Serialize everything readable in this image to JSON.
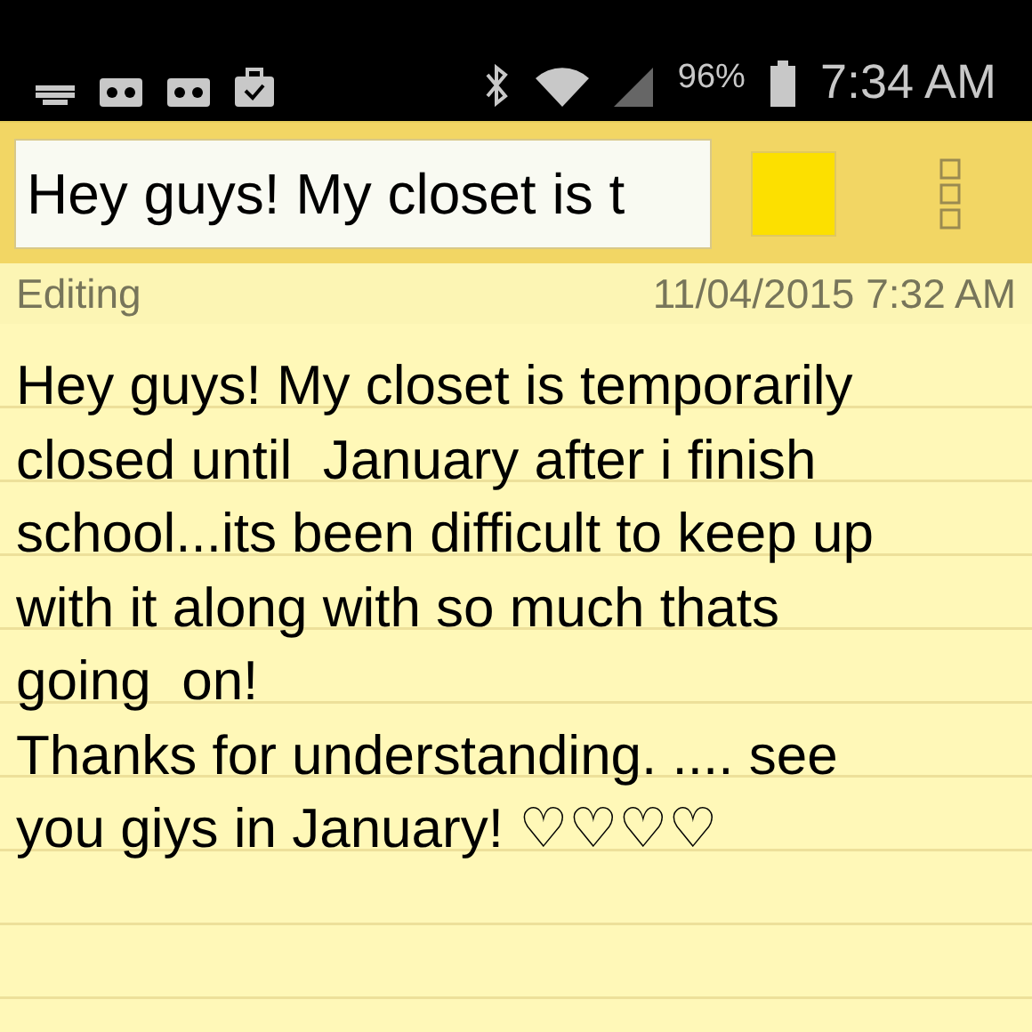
{
  "status_bar": {
    "battery": "96%",
    "time": "7:34 AM"
  },
  "toolbar": {
    "title_field": {
      "value": "Hey guys! My closet is t"
    }
  },
  "info_bar": {
    "mode": "Editing",
    "timestamp": "11/04/2015 7:32 AM"
  },
  "note": {
    "lines": [
      "Hey guys! My closet is temporarily",
      "closed until  January after i finish",
      "school...its been difficult to keep up",
      "with it along with so much thats",
      "going  on!",
      "Thanks for understanding. .... see",
      "you giys in January! ♡♡♡♡"
    ]
  }
}
